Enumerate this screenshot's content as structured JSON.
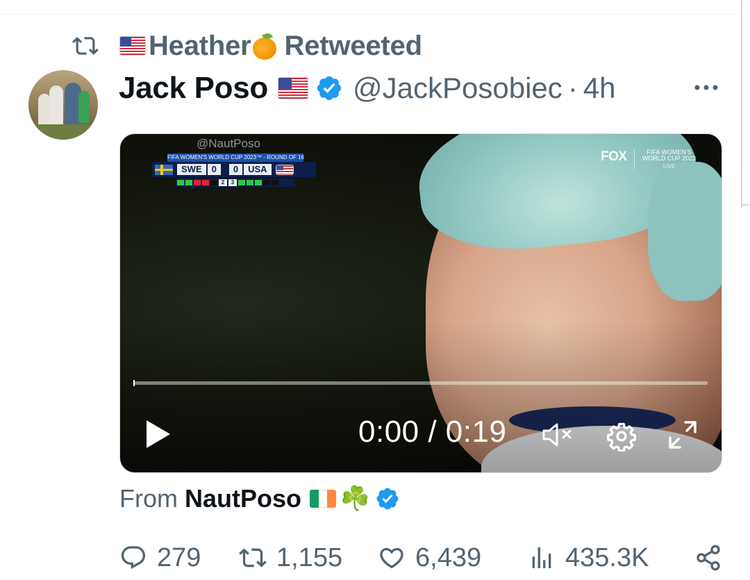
{
  "retweet_bar": {
    "retweeter_name": "Heather",
    "label": "Retweeted"
  },
  "tweet": {
    "author_name": "Jack Poso",
    "handle": "@JackPosobiec",
    "separator": "·",
    "time": "4h",
    "avatar_icon": "family-photo",
    "more_icon": "more-horizontal-icon"
  },
  "video": {
    "watermark": "@NautPoso",
    "scorebug": {
      "header": "FIFA WOMEN'S WORLD CUP 2023™ - ROUND OF 16",
      "team_home": "SWE",
      "score_home": "0",
      "team_away": "USA",
      "score_away": "0",
      "pens_home": "2",
      "pens_away": "3"
    },
    "broadcaster": "FOX",
    "event_logo": "FIFA WOMEN'S WORLD CUP 2023",
    "live_label": "LIVE",
    "time_display": "0:00 / 0:19",
    "progress": 0.0
  },
  "source": {
    "from_label": "From",
    "source_name": "NautPoso",
    "shamrock": "☘️"
  },
  "actions": {
    "replies": "279",
    "retweets": "1,155",
    "likes": "6,439",
    "views": "435.3K"
  },
  "colors": {
    "secondary_text": "#536471",
    "primary_text": "#0f1419",
    "verified_blue": "#1d9bf0"
  }
}
